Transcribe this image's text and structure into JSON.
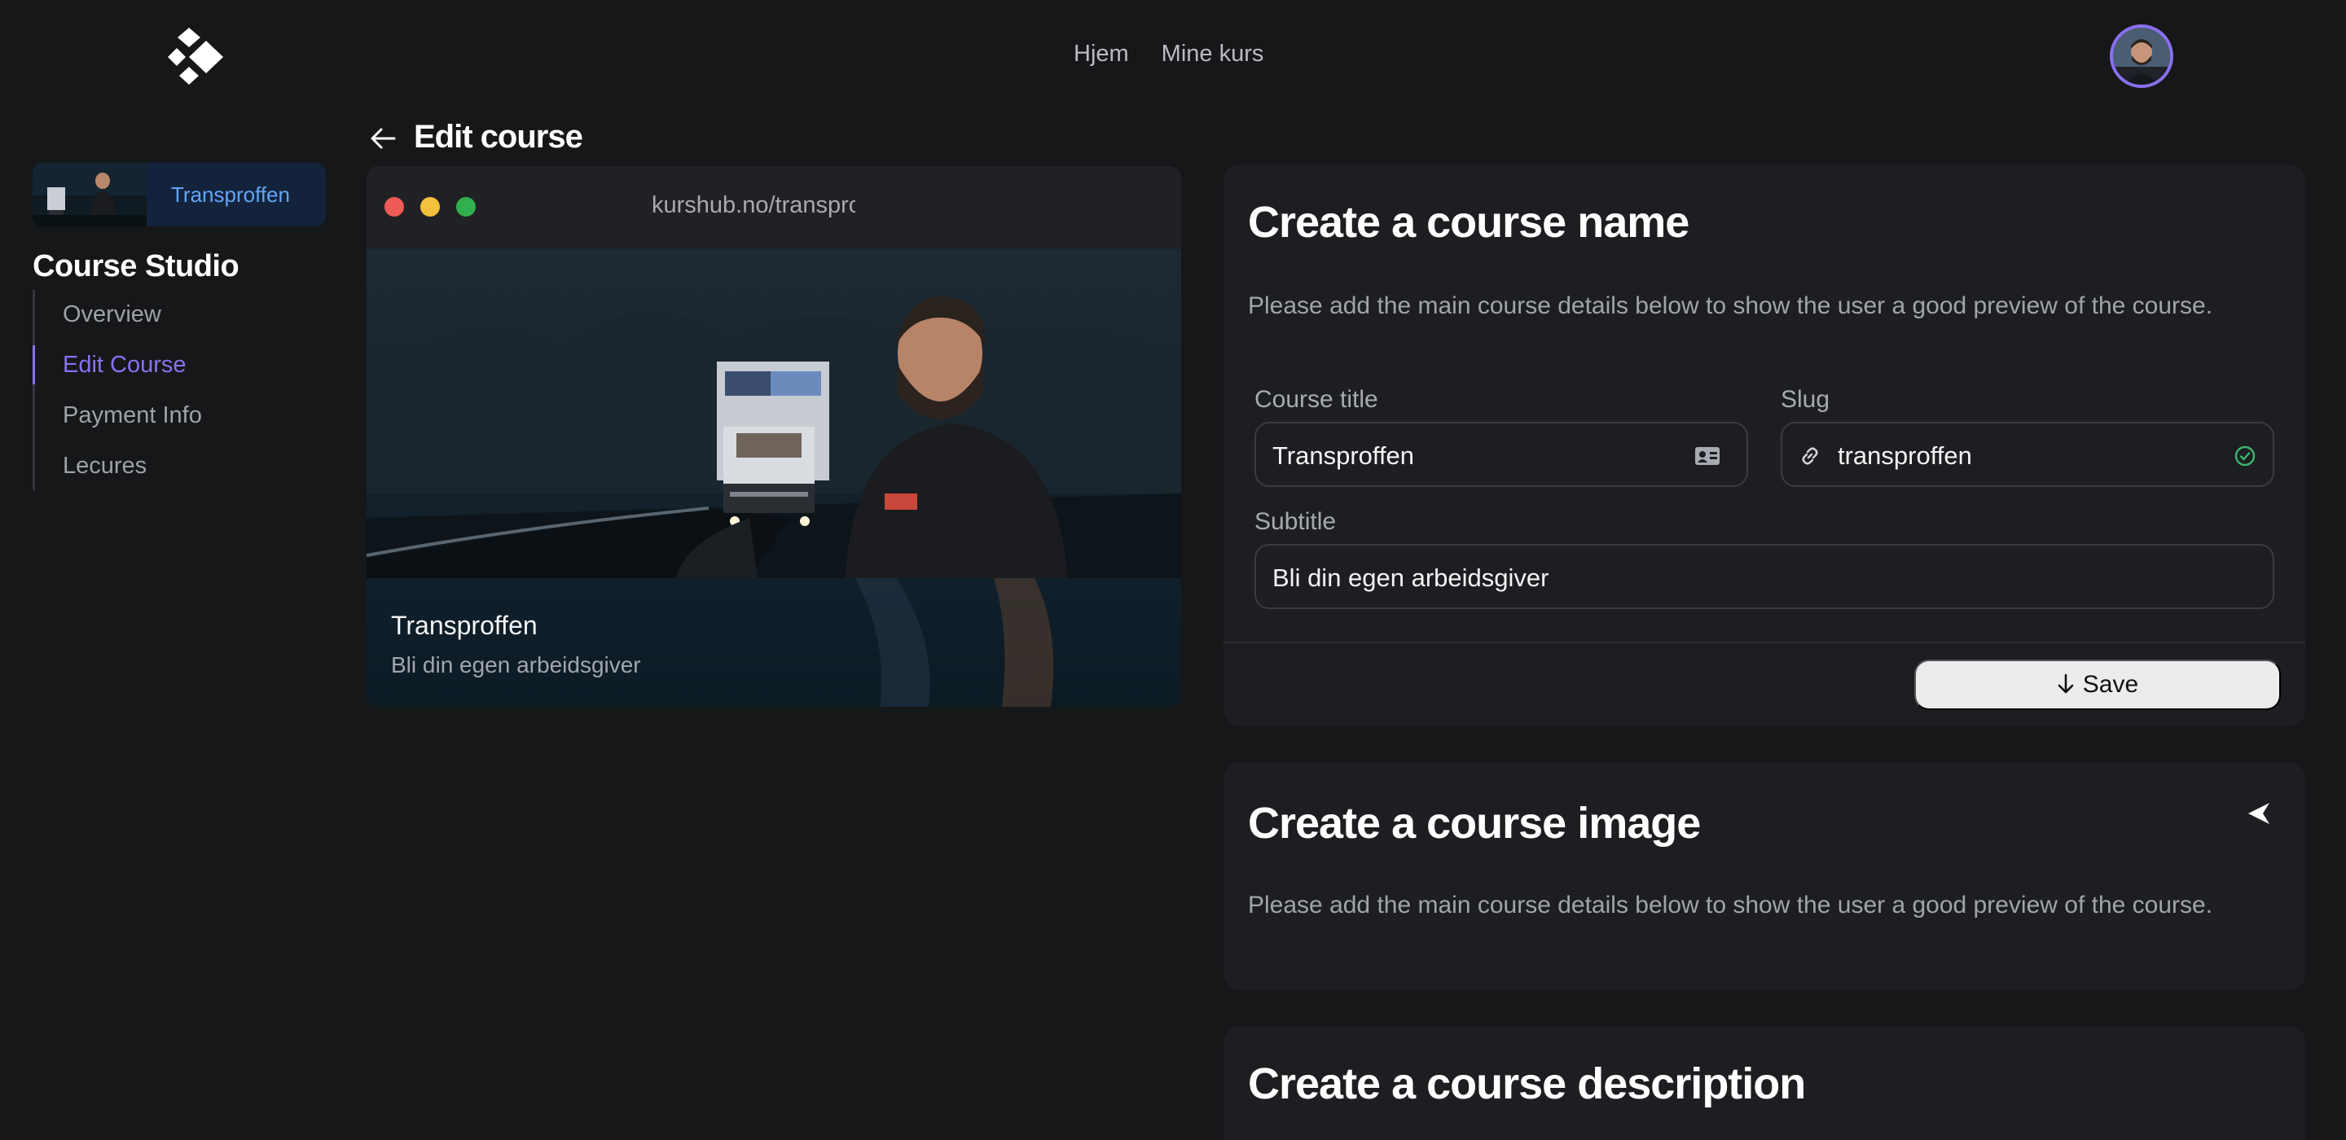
{
  "nav": {
    "home": "Hjem",
    "my_courses": "Mine kurs"
  },
  "sidebar": {
    "course_chip": "Transproffen",
    "studio_title": "Course Studio",
    "items": [
      {
        "label": "Overview",
        "active": false
      },
      {
        "label": "Edit Course",
        "active": true
      },
      {
        "label": "Payment Info",
        "active": false
      },
      {
        "label": "Lecures",
        "active": false
      }
    ]
  },
  "page": {
    "title": "Edit course"
  },
  "preview": {
    "url": "kurshub.no/transproffen",
    "title": "Transproffen",
    "subtitle": "Bli din egen arbeidsgiver"
  },
  "name_card": {
    "title": "Create a course name",
    "description": "Please add the main course details below to show the user a good preview of the course.",
    "course_title_label": "Course title",
    "course_title_value": "Transproffen",
    "slug_label": "Slug",
    "slug_value": "transproffen",
    "subtitle_label": "Subtitle",
    "subtitle_value": "Bli din egen arbeidsgiver",
    "save_label": "Save"
  },
  "image_card": {
    "title": "Create a course image",
    "description": "Please add the main course details below to show the user a good preview of the course."
  },
  "description_card": {
    "title": "Create a course description"
  },
  "colors": {
    "background": "#161719",
    "card": "#1d1e21",
    "accent": "#8a71f0",
    "chip_text": "#62a5f6",
    "valid_green": "#3bb56a",
    "traffic_red": "#ee5a55",
    "traffic_yellow": "#f4c13d",
    "traffic_green": "#31b04f"
  },
  "icons": {
    "logo": "kurshub-logo",
    "back": "arrow-left-icon",
    "title_field": "id-card-icon",
    "slug_field": "link-icon",
    "slug_status": "check-circle-icon",
    "save": "arrow-down-icon",
    "image_card_action": "cursor-arrow-icon"
  }
}
